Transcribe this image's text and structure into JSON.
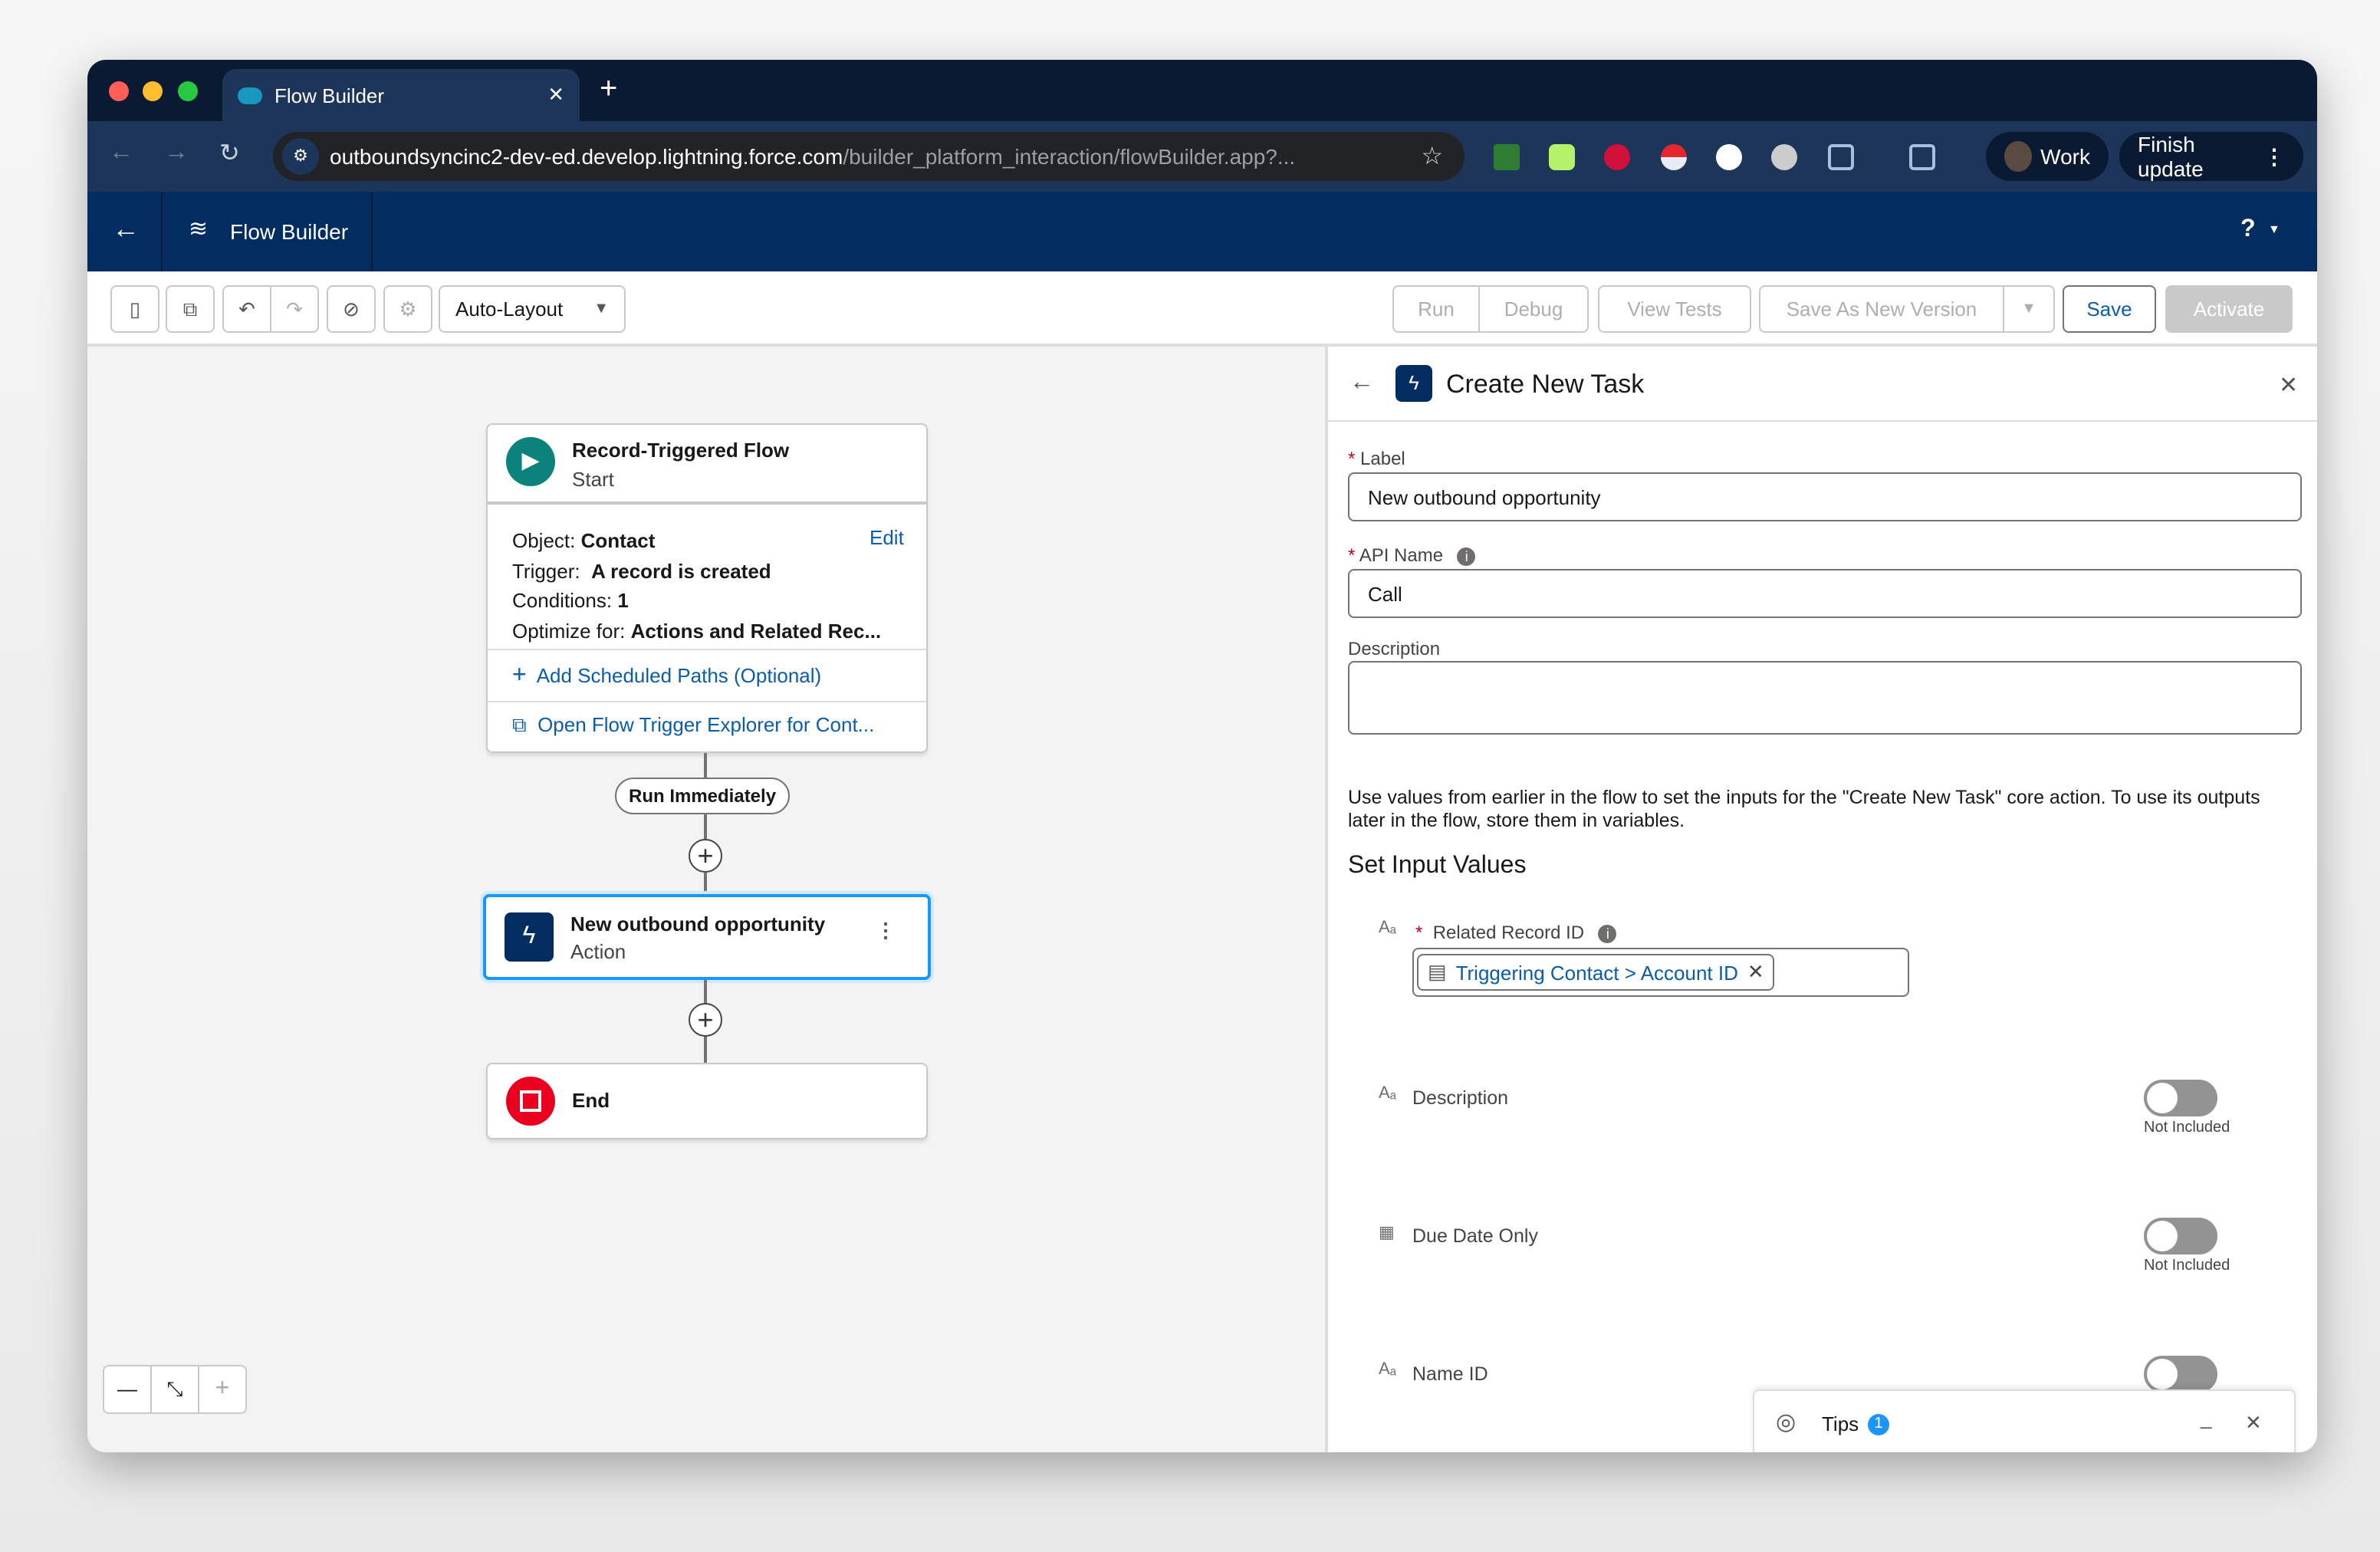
{
  "browser": {
    "tab_title": "Flow Builder",
    "url_host": "outboundsyncinc2-dev-ed.develop.lightning.force.com",
    "url_path": "/builder_platform_interaction/flowBuilder.app?...",
    "profile": "Work",
    "finish_update": "Finish update"
  },
  "app": {
    "title": "Flow Builder",
    "help": "?"
  },
  "toolbar": {
    "layout_select": "Auto-Layout",
    "run": "Run",
    "debug": "Debug",
    "view_tests": "View Tests",
    "save_as_new": "Save As New Version",
    "save": "Save",
    "activate": "Activate"
  },
  "canvas": {
    "start": {
      "title": "Record-Triggered Flow",
      "subtitle": "Start",
      "object_label": "Object:",
      "object": "Contact",
      "edit": "Edit",
      "trigger_label": "Trigger:",
      "trigger": "A record is created",
      "conditions_label": "Conditions:",
      "conditions": "1",
      "optimize_label": "Optimize for:",
      "optimize": "Actions and Related Rec...",
      "add_paths": "Add Scheduled Paths (Optional)",
      "explorer": "Open Flow Trigger Explorer for Cont..."
    },
    "run_badge": "Run Immediately",
    "action": {
      "title": "New outbound opportunity",
      "subtitle": "Action"
    },
    "end": {
      "title": "End"
    }
  },
  "panel": {
    "title": "Create New Task",
    "label_label": "Label",
    "label_value": "New outbound opportunity",
    "api_label": "API Name",
    "api_value": "Call",
    "desc_label": "Description",
    "desc_value": "",
    "help_text": "Use values from earlier in the flow to set the inputs for the \"Create New Task\" core action. To use its outputs later in the flow, store them in variables.",
    "section": "Set Input Values",
    "inputs": [
      {
        "label": "Related Record ID",
        "value": "Triggering Contact > Account ID"
      },
      {
        "label": "Description",
        "state": "Not Included"
      },
      {
        "label": "Due Date Only",
        "state": "Not Included"
      },
      {
        "label": "Name ID"
      }
    ]
  },
  "tips": {
    "label": "Tips",
    "count": "1"
  },
  "colors": {
    "brand": "#032d60",
    "link": "#0b5cab",
    "start": "#0b827c",
    "end": "#ea001e"
  }
}
